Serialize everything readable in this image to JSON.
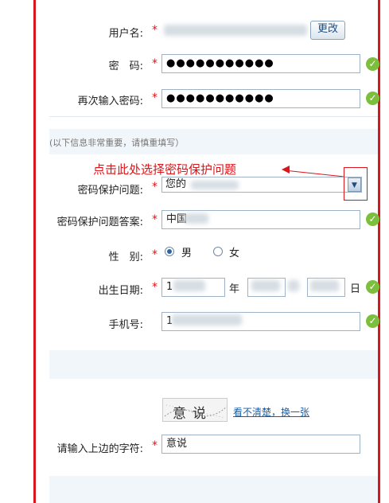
{
  "form": {
    "username": {
      "label": "用户名:",
      "change_button": "更改"
    },
    "password": {
      "label": "密　码:",
      "value": "●●●●●●●●●●●"
    },
    "password_confirm": {
      "label": "再次输入密码:",
      "value": "●●●●●●●●●●●"
    },
    "section_note": "(以下信息非常重要，请慎重填写）",
    "annotation": "点击此处选择密码保护问题",
    "security_question": {
      "label": "密码保护问题:",
      "selected": "您的"
    },
    "security_answer": {
      "label": "密码保护问题答案:",
      "value": "中国"
    },
    "gender": {
      "label": "性　别:",
      "options": [
        "男",
        "女"
      ],
      "selected": "男"
    },
    "birthdate": {
      "label": "出生日期:",
      "year_prefix": "1",
      "year_unit": "年",
      "day_unit": "日"
    },
    "mobile": {
      "label": "手机号:",
      "value_prefix": "1"
    },
    "captcha": {
      "image_text": "意说",
      "refresh_link": "看不清楚，换一张",
      "label": "请输入上边的字符:",
      "value": "意说"
    },
    "required_mark": "*",
    "valid_mark": "✓"
  },
  "colors": {
    "frame": "#d8161b",
    "valid": "#7cbf3c",
    "link": "#1a5fa6"
  }
}
